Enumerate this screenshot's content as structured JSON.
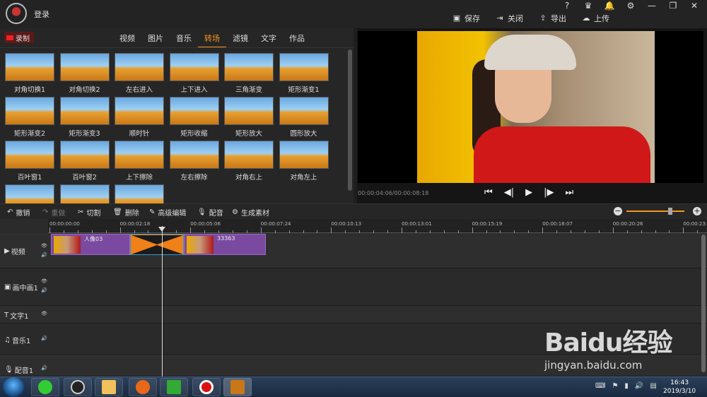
{
  "titlebar": {
    "login_label": "登录",
    "window_icons": [
      "?",
      "VIP",
      "bell",
      "gear",
      "minimize",
      "restore",
      "close"
    ],
    "actions": [
      {
        "icon": "save-icon",
        "label": "保存"
      },
      {
        "icon": "close-project-icon",
        "label": "关闭"
      },
      {
        "icon": "export-icon",
        "label": "导出"
      },
      {
        "icon": "upload-icon",
        "label": "上传"
      }
    ]
  },
  "left_panel": {
    "record_label": "录制",
    "tabs": [
      "视频",
      "图片",
      "音乐",
      "转场",
      "滤镜",
      "文字",
      "作品"
    ],
    "active_tab": "转场",
    "transitions": [
      "对角切换1",
      "对角切换2",
      "左右进入",
      "上下进入",
      "三角渐变",
      "矩形渐变1",
      "矩形渐变2",
      "矩形渐变3",
      "顺时针",
      "矩形收缩",
      "矩形放大",
      "圆形放大",
      "百叶窗1",
      "百叶窗2",
      "上下擦除",
      "左右擦除",
      "对角右上",
      "对角左上",
      "",
      "",
      ""
    ]
  },
  "preview": {
    "timecode": "00:00:04:06/00:00:08:18",
    "controls": [
      "skip-start",
      "step-back",
      "play",
      "step-forward",
      "skip-end"
    ]
  },
  "toolbar": {
    "items": [
      {
        "label": "撤销",
        "icon": "undo-icon",
        "enabled": true
      },
      {
        "label": "重做",
        "icon": "redo-icon",
        "enabled": false
      },
      {
        "label": "切割",
        "icon": "scissors-icon",
        "enabled": true
      },
      {
        "label": "删除",
        "icon": "trash-icon",
        "enabled": true
      },
      {
        "label": "高级编辑",
        "icon": "pencil-icon",
        "enabled": true
      },
      {
        "label": "配音",
        "icon": "mic-icon",
        "enabled": true
      },
      {
        "label": "生成素材",
        "icon": "gear-icon",
        "enabled": true
      }
    ],
    "zoom_level": 0.75
  },
  "timeline": {
    "ruler_labels": [
      "00:00:00:00",
      "00:00:02:18",
      "00:00:05:06",
      "00:00:07:24",
      "00:00:10:13",
      "00:00:13:01",
      "00:00:15:19",
      "00:00:18:07",
      "00:00:20:26",
      "00:00:23:"
    ],
    "tracks": [
      {
        "name": "视频",
        "icon": "play-icon"
      },
      {
        "name": "画中画1",
        "icon": "pip-icon"
      },
      {
        "name": "文字1",
        "icon": "text-icon"
      },
      {
        "name": "音乐1",
        "icon": "music-icon"
      },
      {
        "name": "配音1",
        "icon": "mic-icon"
      }
    ],
    "clips": [
      {
        "label": "人像03"
      },
      {
        "label": "33363"
      }
    ]
  },
  "watermark": {
    "logo": "Baidu经验",
    "url": "jingyan.baidu.com"
  },
  "taskbar": {
    "time": "16:43",
    "date": "2019/3/10"
  }
}
